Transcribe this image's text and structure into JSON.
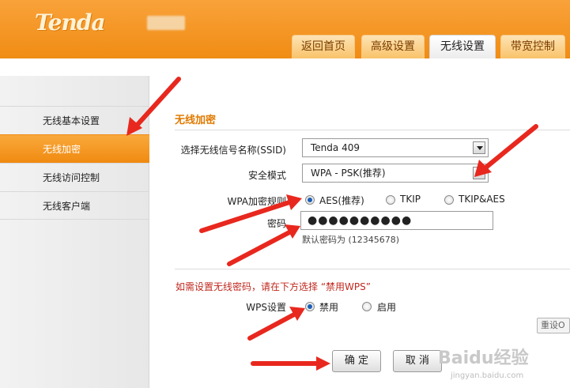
{
  "header": {
    "logo": "Tenda",
    "tabs": [
      {
        "label": "返回首页"
      },
      {
        "label": "高级设置"
      },
      {
        "label": "无线设置"
      },
      {
        "label": "带宽控制"
      }
    ]
  },
  "sidebar": {
    "items": [
      {
        "label": "无线基本设置"
      },
      {
        "label": "无线加密"
      },
      {
        "label": "无线访问控制"
      },
      {
        "label": "无线客户端"
      }
    ]
  },
  "form": {
    "title": "无线加密",
    "ssid_label": "选择无线信号名称(SSID)",
    "ssid_value": "Tenda 409",
    "security_label": "安全模式",
    "security_value": "WPA - PSK(推荐)",
    "wpa_label": "WPA加密规则",
    "wpa_options": [
      {
        "label": "AES(推荐)",
        "selected": true
      },
      {
        "label": "TKIP",
        "selected": false
      },
      {
        "label": "TKIP&AES",
        "selected": false
      }
    ],
    "password_label": "密码",
    "password_value": "●●●●●●●●●●",
    "password_hint": "默认密码为 (12345678)",
    "wps_note": "如需设置无线密码，请在下方选择 “禁用WPS”",
    "wps_label": "WPS设置",
    "wps_options": [
      {
        "label": "禁用",
        "selected": true
      },
      {
        "label": "启用",
        "selected": false
      }
    ],
    "reset_label": "重设O",
    "confirm_label": "确 定",
    "cancel_label": "取 消"
  },
  "watermark": {
    "text": "Baidu经验",
    "url": "jingyan.baidu.com"
  },
  "colors": {
    "header_orange": "#f08c14",
    "active_orange": "#f5a02d",
    "title_orange": "#e07a00",
    "note_red": "#c0281e",
    "arrow_red": "#e8281e"
  }
}
